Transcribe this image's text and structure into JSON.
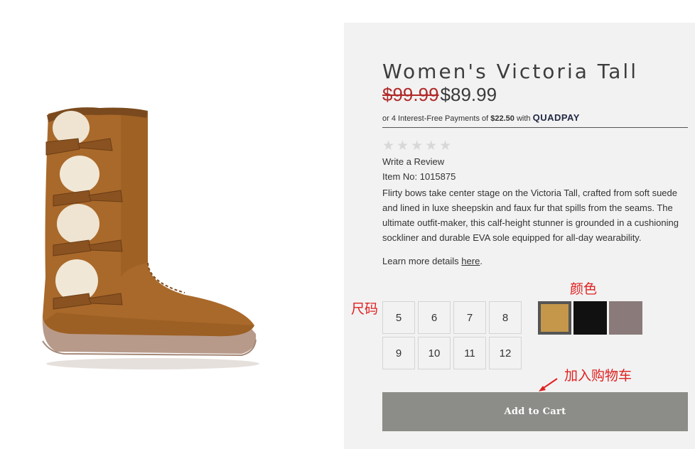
{
  "product": {
    "title": "Women's Victoria Tall",
    "old_price": "$99.99",
    "new_price": "$89.99",
    "installment": {
      "prefix": "or 4 Interest-Free Payments of",
      "amount": "$22.50",
      "with": "with",
      "provider": "QUADPAY"
    },
    "rating": {
      "stars": "★★★★★",
      "value": 0,
      "max": 5
    },
    "write_review": "Write a Review",
    "item_no": "Item No: 1015875",
    "description": "Flirty bows take center stage on the Victoria Tall, crafted from soft suede and lined in luxe sheepskin and faux fur that spills from the seams. The ultimate outfit-maker, this calf-height stunner is grounded in a cushioning sockliner and durable EVA sole equipped for all-day wearability.",
    "learn_more_prefix": "Learn more details",
    "learn_more_link": "here",
    "learn_more_suffix": ".",
    "sizes": [
      "5",
      "6",
      "7",
      "8",
      "9",
      "10",
      "11",
      "12"
    ],
    "colors": [
      {
        "name": "chestnut",
        "hex": "#c4974a",
        "selected": true
      },
      {
        "name": "black",
        "hex": "#111111",
        "selected": false
      },
      {
        "name": "gray",
        "hex": "#8a7a7a",
        "selected": false
      }
    ],
    "add_to_cart": "Add to Cart"
  },
  "annotations": {
    "size_label": "尺码",
    "color_label": "颜色",
    "cart_label": "加入购物车"
  },
  "colors": {
    "panel_bg": "#f2f2f2",
    "old_price": "#b12a2a",
    "button_bg": "#8c8c88",
    "annotation": "#e02020"
  },
  "image": {
    "subject": "tall-suede-boot-with-fur-bows"
  }
}
